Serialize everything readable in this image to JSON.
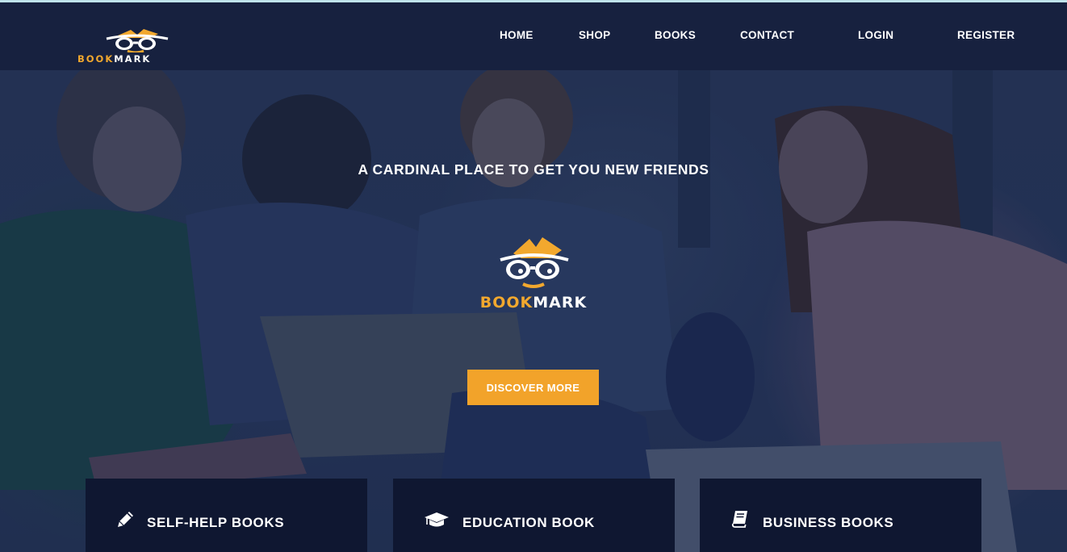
{
  "brand": {
    "name_part1": "BOOK",
    "name_part2": "MARK",
    "accent_color": "#f2a82e",
    "nav_background": "#17213f"
  },
  "nav": {
    "items": [
      {
        "label": "HOME"
      },
      {
        "label": "SHOP"
      },
      {
        "label": "BOOKS"
      },
      {
        "label": "CONTACT"
      },
      {
        "label": "LOGIN"
      },
      {
        "label": "REGISTER"
      }
    ]
  },
  "hero": {
    "tagline": "A CARDINAL PLACE TO GET YOU NEW FRIENDS",
    "cta_label": "DISCOVER MORE",
    "cta_color": "#f2a32a"
  },
  "categories": [
    {
      "icon": "pencil-icon",
      "label": "SELF-HELP BOOKS"
    },
    {
      "icon": "graduation-cap-icon",
      "label": "EDUCATION BOOK"
    },
    {
      "icon": "book-icon",
      "label": "BUSINESS BOOKS"
    }
  ]
}
